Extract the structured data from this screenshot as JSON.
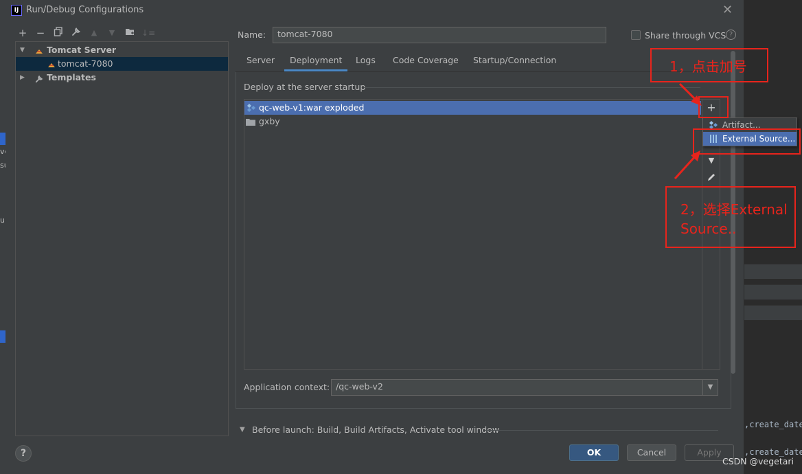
{
  "window": {
    "title": "Run/Debug Configurations",
    "app_icon": "IJ"
  },
  "toolbar": {
    "icons": [
      "add-icon",
      "remove-icon",
      "copy-icon",
      "wrench-icon",
      "move-up-icon",
      "move-down-icon",
      "new-folder-icon",
      "sort-icon"
    ]
  },
  "tree": {
    "items": [
      {
        "label": "Tomcat Server",
        "icon": "tomcat-icon",
        "expanded": true
      },
      {
        "label": "tomcat-7080",
        "icon": "tomcat-icon",
        "selected": true
      },
      {
        "label": "Templates",
        "icon": "wrench-icon",
        "expanded": false
      }
    ]
  },
  "form": {
    "name_label": "Name:",
    "name_value": "tomcat-7080",
    "share_label": "Share through VCS",
    "share_checked": false,
    "help_glyph": "?"
  },
  "tabs": [
    {
      "label": "Server",
      "active": false
    },
    {
      "label": "Deployment",
      "active": true
    },
    {
      "label": "Logs",
      "active": false
    },
    {
      "label": "Code Coverage",
      "active": false
    },
    {
      "label": "Startup/Connection",
      "active": false
    }
  ],
  "deploy": {
    "group_label": "Deploy at the server startup",
    "items": [
      {
        "label": "qc-web-v1:war exploded",
        "icon": "artifact-icon",
        "selected": true
      },
      {
        "label": "gxby",
        "icon": "folder-icon",
        "selected": false
      }
    ],
    "popup": [
      {
        "label": "Artifact...",
        "icon": "artifact-icon",
        "highlighted": false
      },
      {
        "label": "External Source...",
        "icon": "external-source-icon",
        "highlighted": true
      }
    ],
    "context_label": "Application context:",
    "context_value": "/qc-web-v2"
  },
  "before_launch": {
    "label": "Before launch: Build, Build Artifacts, Activate tool window"
  },
  "buttons": {
    "ok": "OK",
    "cancel": "Cancel",
    "apply": "Apply"
  },
  "annotations": {
    "step1": "1，点击加号",
    "step2_line1": "2，选择External",
    "step2_line2": "Source..",
    "color": "#e8241c"
  },
  "background": {
    "code_lines": [
      ",create_date",
      ",create_date"
    ],
    "left_fragments": [
      "ve",
      "su",
      "ul"
    ]
  },
  "watermark": "CSDN @vegetari",
  "colors": {
    "dialog_bg": "#3c3f41",
    "selection": "#4b6eaf",
    "accent": "#4a88c7",
    "primary_button": "#365880"
  }
}
